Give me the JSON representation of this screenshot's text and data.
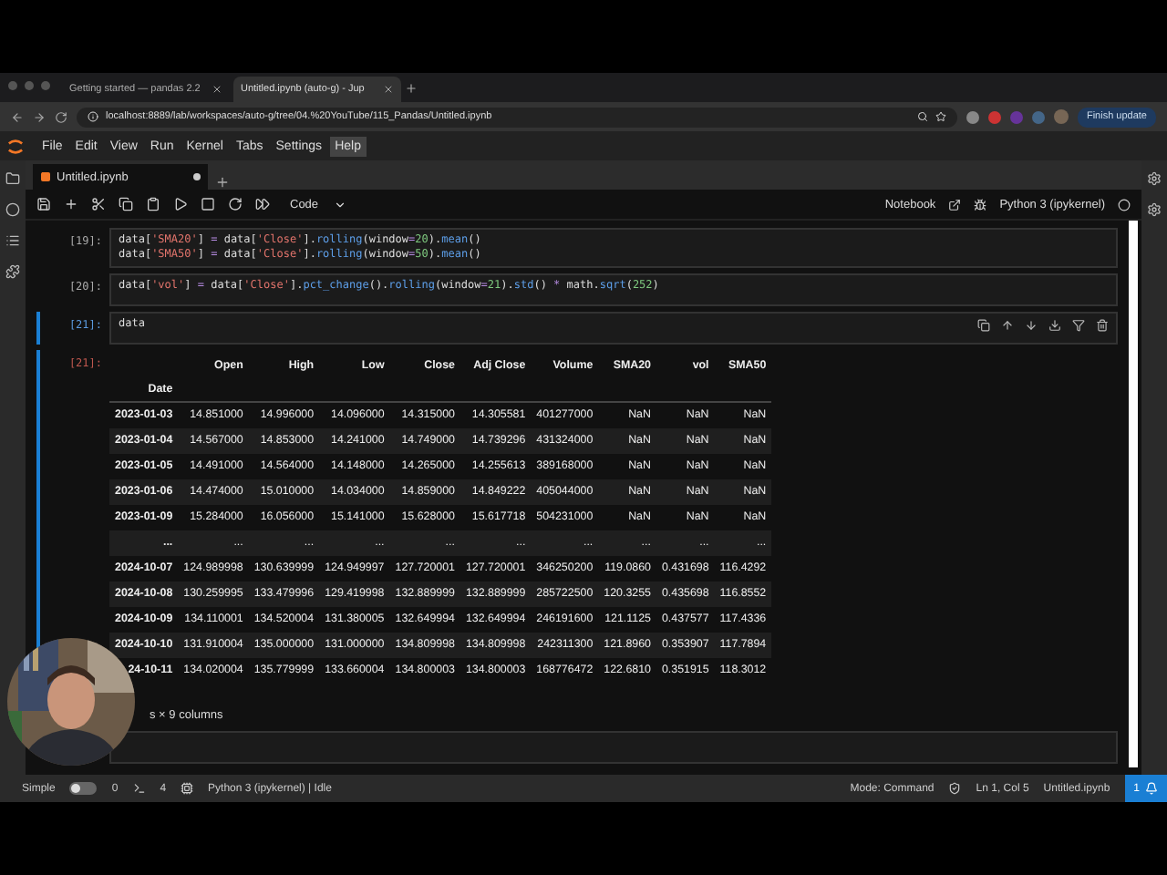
{
  "browser": {
    "tabs": [
      {
        "title": "Getting started — pandas 2.2",
        "selected": false
      },
      {
        "title": "Untitled.ipynb (auto-g) - Jup",
        "selected": true
      }
    ],
    "url": "localhost:8889/lab/workspaces/auto-g/tree/04.%20YouTube/115_Pandas/Untitled.ipynb",
    "update_button": "Finish update"
  },
  "menu": [
    {
      "label": "File",
      "selected": false
    },
    {
      "label": "Edit",
      "selected": false
    },
    {
      "label": "View",
      "selected": false
    },
    {
      "label": "Run",
      "selected": false
    },
    {
      "label": "Kernel",
      "selected": false
    },
    {
      "label": "Tabs",
      "selected": false
    },
    {
      "label": "Settings",
      "selected": false
    },
    {
      "label": "Help",
      "selected": true
    }
  ],
  "notebook_tab": {
    "title": "Untitled.ipynb",
    "modified": true
  },
  "toolbar": {
    "cell_type": "Code",
    "notebook_label": "Notebook",
    "kernel": "Python 3 (ipykernel)"
  },
  "cells": [
    {
      "prompt": "[19]:",
      "active": false,
      "lines": [
        [
          {
            "kind": "name",
            "t": "data["
          },
          {
            "kind": "string",
            "t": "'SMA20'"
          },
          {
            "kind": "name",
            "t": "] "
          },
          {
            "kind": "operator",
            "t": "="
          },
          {
            "kind": "name",
            "t": " data["
          },
          {
            "kind": "string",
            "t": "'Close'"
          },
          {
            "kind": "name",
            "t": "]."
          },
          {
            "kind": "function",
            "t": "rolling"
          },
          {
            "kind": "name",
            "t": "(window"
          },
          {
            "kind": "operator",
            "t": "="
          },
          {
            "kind": "number",
            "t": "20"
          },
          {
            "kind": "name",
            "t": ")."
          },
          {
            "kind": "function",
            "t": "mean"
          },
          {
            "kind": "name",
            "t": "()"
          }
        ],
        [
          {
            "kind": "name",
            "t": "data["
          },
          {
            "kind": "string",
            "t": "'SMA50'"
          },
          {
            "kind": "name",
            "t": "] "
          },
          {
            "kind": "operator",
            "t": "="
          },
          {
            "kind": "name",
            "t": " data["
          },
          {
            "kind": "string",
            "t": "'Close'"
          },
          {
            "kind": "name",
            "t": "]."
          },
          {
            "kind": "function",
            "t": "rolling"
          },
          {
            "kind": "name",
            "t": "(window"
          },
          {
            "kind": "operator",
            "t": "="
          },
          {
            "kind": "number",
            "t": "50"
          },
          {
            "kind": "name",
            "t": ")."
          },
          {
            "kind": "function",
            "t": "mean"
          },
          {
            "kind": "name",
            "t": "()"
          }
        ]
      ]
    },
    {
      "prompt": "[20]:",
      "active": false,
      "lines": [
        [
          {
            "kind": "name",
            "t": "data["
          },
          {
            "kind": "string",
            "t": "'vol'"
          },
          {
            "kind": "name",
            "t": "] "
          },
          {
            "kind": "operator",
            "t": "="
          },
          {
            "kind": "name",
            "t": " data["
          },
          {
            "kind": "string",
            "t": "'Close'"
          },
          {
            "kind": "name",
            "t": "]."
          },
          {
            "kind": "function",
            "t": "pct_change"
          },
          {
            "kind": "name",
            "t": "()."
          },
          {
            "kind": "function",
            "t": "rolling"
          },
          {
            "kind": "name",
            "t": "(window"
          },
          {
            "kind": "operator",
            "t": "="
          },
          {
            "kind": "number",
            "t": "21"
          },
          {
            "kind": "name",
            "t": ")."
          },
          {
            "kind": "function",
            "t": "std"
          },
          {
            "kind": "name",
            "t": "() "
          },
          {
            "kind": "operator",
            "t": "*"
          },
          {
            "kind": "name",
            "t": " math."
          },
          {
            "kind": "function",
            "t": "sqrt"
          },
          {
            "kind": "name",
            "t": "("
          },
          {
            "kind": "number",
            "t": "252"
          },
          {
            "kind": "name",
            "t": ")"
          }
        ]
      ]
    },
    {
      "prompt": "[21]:",
      "active": true,
      "lines": [
        [
          {
            "kind": "name",
            "t": "data"
          }
        ]
      ],
      "output": {
        "prompt": "[21]:",
        "columns": [
          "Open",
          "High",
          "Low",
          "Close",
          "Adj Close",
          "Volume",
          "SMA20",
          "vol",
          "SMA50"
        ],
        "index_name": "Date",
        "rows": [
          {
            "index": "2023-01-03",
            "values": [
              "14.851000",
              "14.996000",
              "14.096000",
              "14.315000",
              "14.305581",
              "401277000",
              "NaN",
              "NaN",
              "NaN"
            ]
          },
          {
            "index": "2023-01-04",
            "values": [
              "14.567000",
              "14.853000",
              "14.241000",
              "14.749000",
              "14.739296",
              "431324000",
              "NaN",
              "NaN",
              "NaN"
            ]
          },
          {
            "index": "2023-01-05",
            "values": [
              "14.491000",
              "14.564000",
              "14.148000",
              "14.265000",
              "14.255613",
              "389168000",
              "NaN",
              "NaN",
              "NaN"
            ]
          },
          {
            "index": "2023-01-06",
            "values": [
              "14.474000",
              "15.010000",
              "14.034000",
              "14.859000",
              "14.849222",
              "405044000",
              "NaN",
              "NaN",
              "NaN"
            ]
          },
          {
            "index": "2023-01-09",
            "values": [
              "15.284000",
              "16.056000",
              "15.141000",
              "15.628000",
              "15.617718",
              "504231000",
              "NaN",
              "NaN",
              "NaN"
            ]
          },
          {
            "index": "...",
            "values": [
              "...",
              "...",
              "...",
              "...",
              "...",
              "...",
              "...",
              "...",
              "..."
            ]
          },
          {
            "index": "2024-10-07",
            "values": [
              "124.989998",
              "130.639999",
              "124.949997",
              "127.720001",
              "127.720001",
              "346250200",
              "119.0860",
              "0.431698",
              "116.4292"
            ]
          },
          {
            "index": "2024-10-08",
            "values": [
              "130.259995",
              "133.479996",
              "129.419998",
              "132.889999",
              "132.889999",
              "285722500",
              "120.3255",
              "0.435698",
              "116.8552"
            ]
          },
          {
            "index": "2024-10-09",
            "values": [
              "134.110001",
              "134.520004",
              "131.380005",
              "132.649994",
              "132.649994",
              "246191600",
              "121.1125",
              "0.437577",
              "117.4336"
            ]
          },
          {
            "index": "2024-10-10",
            "values": [
              "131.910004",
              "135.000000",
              "131.000000",
              "134.809998",
              "134.809998",
              "242311300",
              "121.8960",
              "0.353907",
              "117.7894"
            ]
          },
          {
            "index": "24-10-11",
            "values": [
              "134.020004",
              "135.779999",
              "133.660004",
              "134.800003",
              "134.800003",
              "168776472",
              "122.6810",
              "0.351915",
              "118.3012"
            ]
          }
        ],
        "footer": "s × 9 columns"
      }
    },
    {
      "active": false
    }
  ],
  "status": {
    "mode_label": "Simple",
    "simple_on": false,
    "terminals": "0",
    "kernels": "4",
    "kernel_status": "Python 3 (ipykernel) | Idle",
    "mode": "Mode: Command",
    "position": "Ln 1, Col 5",
    "file": "Untitled.ipynb",
    "notifications": "1"
  }
}
